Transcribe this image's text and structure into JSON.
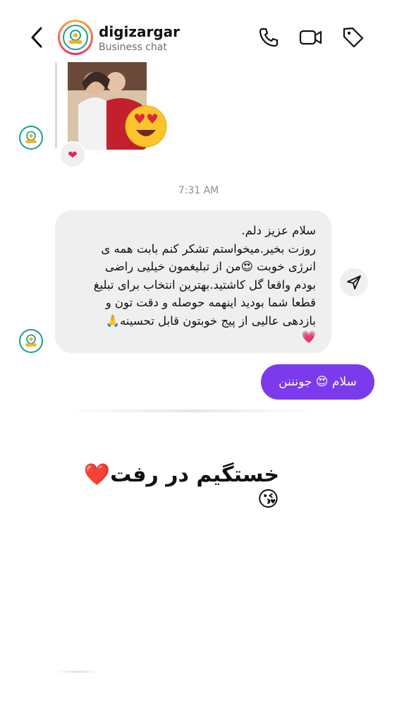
{
  "header": {
    "name": "digizargar",
    "subtitle": "Business chat",
    "icons": [
      "back-arrow-icon",
      "phone-icon",
      "video-camera-icon",
      "tag-icon"
    ]
  },
  "thread": {
    "timestamp": "7:31 AM",
    "incoming_message": {
      "lines": [
        "سلام عزیز دلم.",
        "روزت بخیر.میخواستم تشکر کنم بابت همه ی",
        "انرژی خوبت 😍من از تبلیغمون خیلیی راضی",
        "بودم واقعا گل کاشتید.بهترین انتخاب برای تبلیغ",
        "قطعا شما بودید اینهمه حوصله و دقت تون و",
        "بازدهی عالیی از پیج خوبتون قابل تحسینه🙏",
        "💗"
      ]
    },
    "outgoing_message": {
      "text": "سلام 😍 جونننن"
    },
    "reaction": "❤"
  },
  "caption": {
    "text": "خستگیم در رفت❤️😘"
  },
  "colors": {
    "accent": "#7c3aed",
    "incoming_bubble": "#efefef",
    "logo_teal": "#1a9e8f"
  }
}
